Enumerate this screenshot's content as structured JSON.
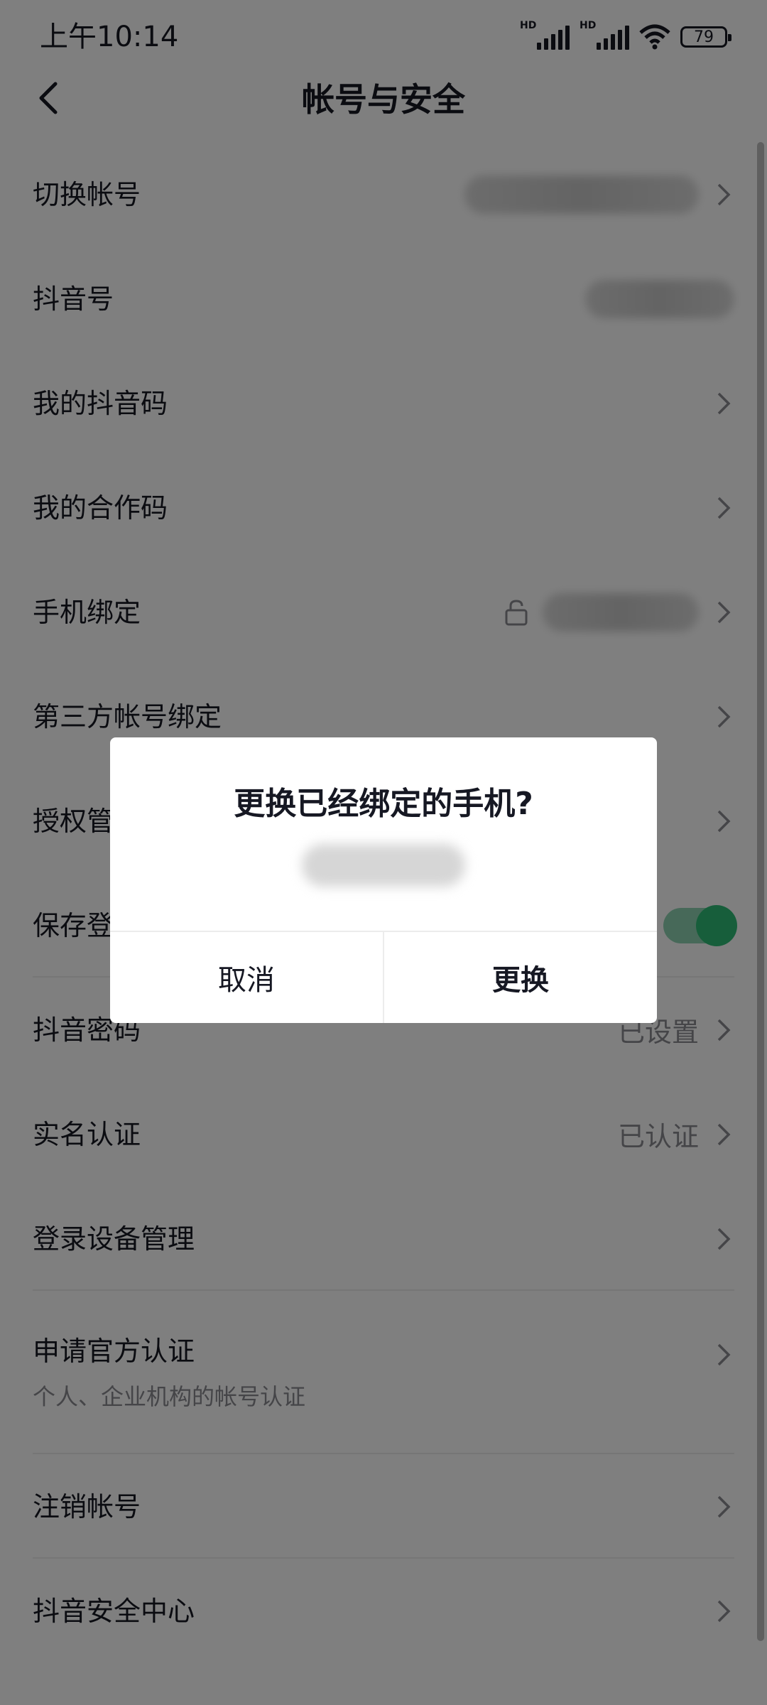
{
  "status_bar": {
    "time": "上午10:14",
    "signal_labels": [
      "HD",
      "HD"
    ],
    "battery": "79",
    "icons": [
      "signal-icon",
      "signal-icon",
      "wifi-icon",
      "battery-icon"
    ]
  },
  "nav": {
    "title": "帐号与安全",
    "back_icon": "chevron-left-icon"
  },
  "rows": [
    {
      "label": "切换帐号"
    },
    {
      "label": "抖音号"
    },
    {
      "label": "我的抖音码"
    },
    {
      "label": "我的合作码"
    },
    {
      "label": "手机绑定"
    },
    {
      "label": "第三方帐号绑定"
    },
    {
      "label": "授权管理"
    },
    {
      "label": "保存登录信息",
      "toggle_on": true
    },
    {
      "label": "抖音密码",
      "value": "已设置"
    },
    {
      "label": "实名认证",
      "value": "已认证"
    },
    {
      "label": "登录设备管理"
    },
    {
      "label": "申请官方认证",
      "sub": "个人、企业机构的帐号认证"
    },
    {
      "label": "注销帐号"
    },
    {
      "label": "抖音安全中心"
    }
  ],
  "dialog": {
    "title": "更换已经绑定的手机?",
    "cancel_label": "取消",
    "confirm_label": "更换"
  },
  "colors": {
    "accent_green": "#2ebd77",
    "overlay": "rgba(0,0,0,0.5)"
  }
}
